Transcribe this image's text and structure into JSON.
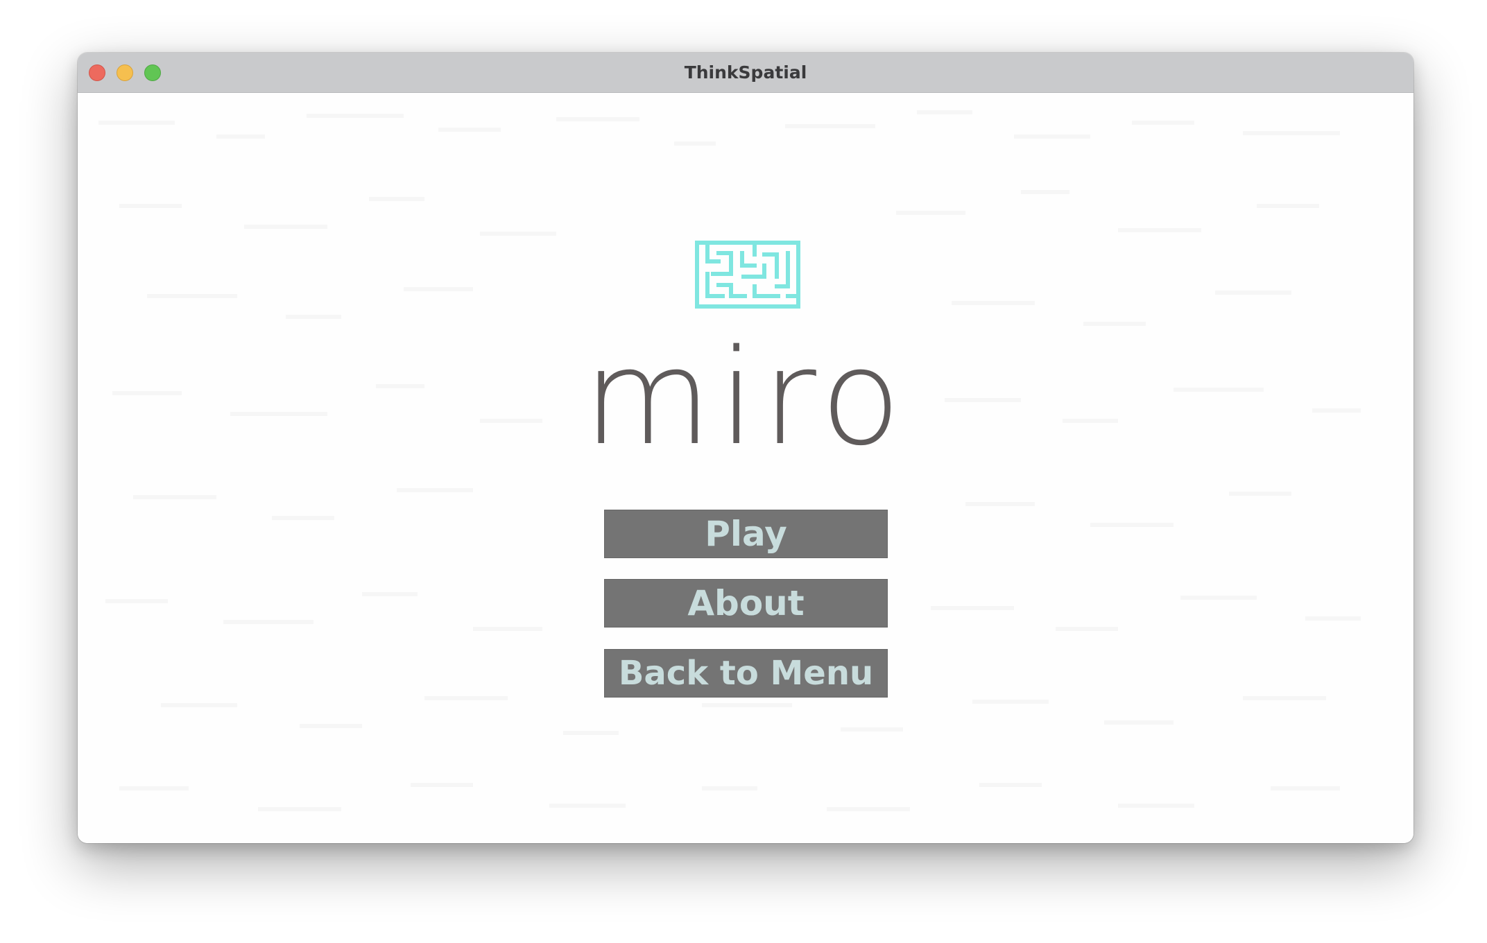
{
  "window": {
    "title": "ThinkSpatial",
    "controls": [
      "close-icon",
      "minimize-icon",
      "zoom-icon"
    ]
  },
  "app": {
    "logo_icon": "maze-icon",
    "wordmark": "miro",
    "colors": {
      "logo": "#7fe6e0",
      "wordmark": "#5f5b5b",
      "button_bg": "#747474",
      "button_text": "#c8dcdc"
    }
  },
  "menu": {
    "play_label": "Play",
    "about_label": "About",
    "back_label": "Back to Menu"
  }
}
